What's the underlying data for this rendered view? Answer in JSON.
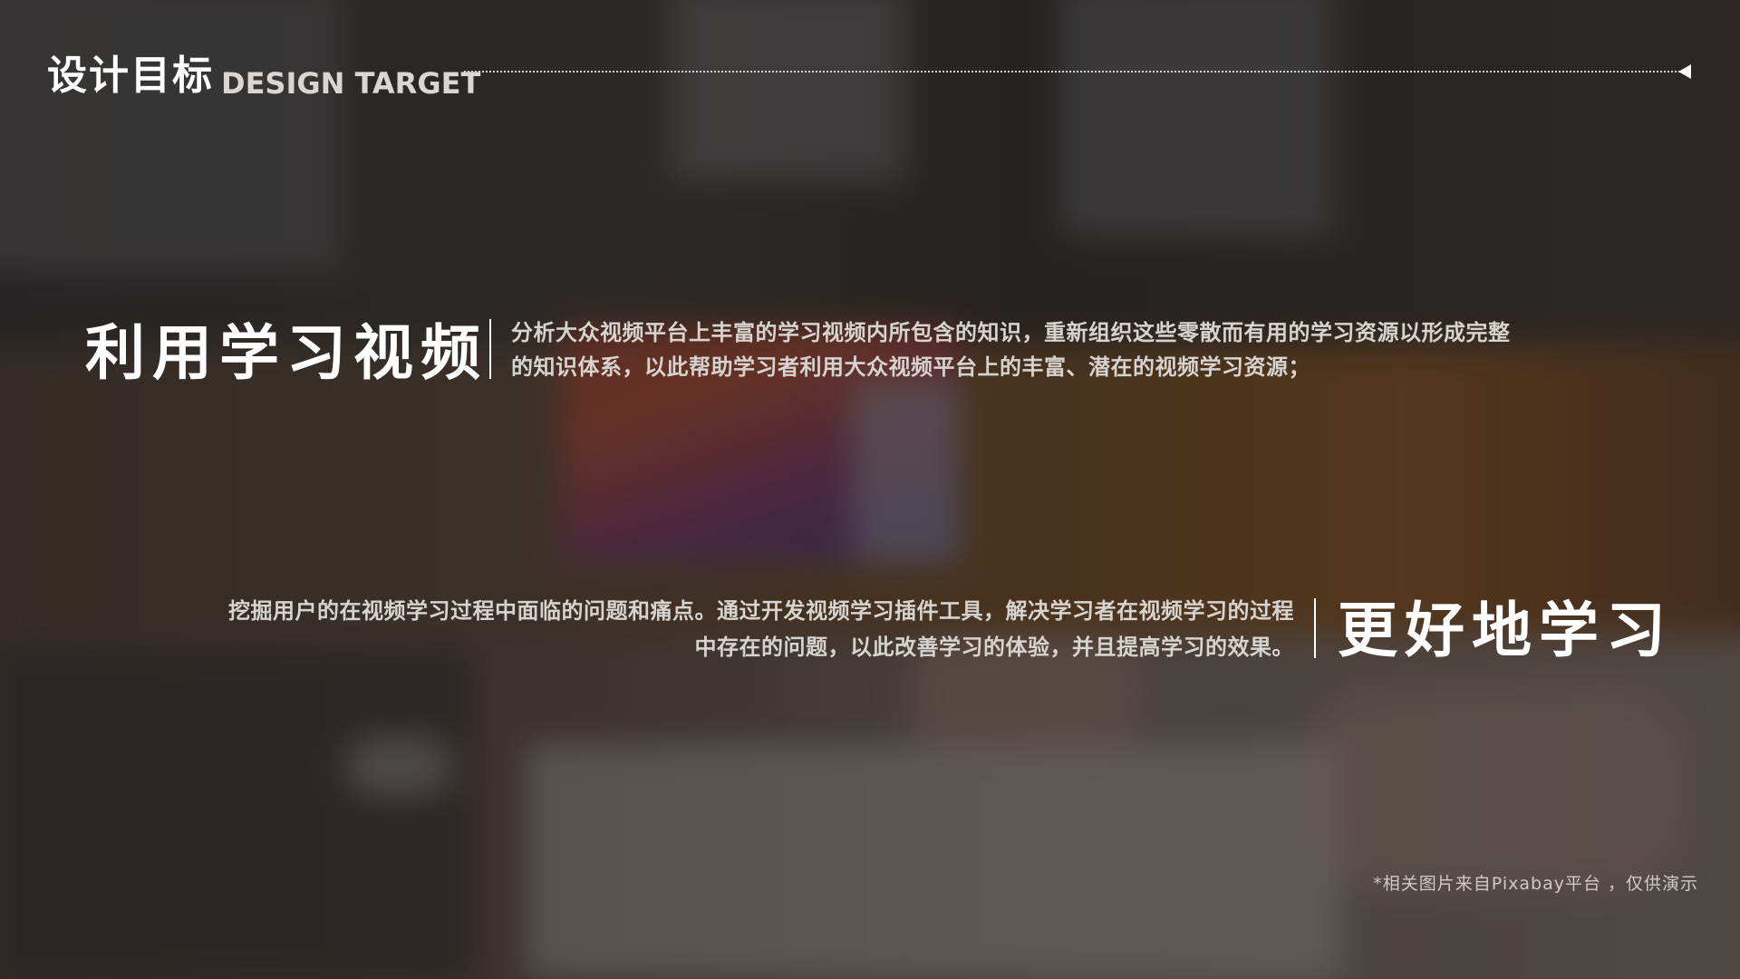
{
  "header": {
    "title": "设计目标",
    "subtitle": "DESIGN TARGET"
  },
  "blocks": [
    {
      "title": "利用学习视频",
      "text_line1": "分析大众视频平台上丰富的学习视频内所包含的知识，重新组织这些零散而有用的学习资源以形成完整",
      "text_line2": "的知识体系，以此帮助学习者利用大众视频平台上的丰富、潜在的视频学习资源；"
    },
    {
      "title": "更好地学习",
      "text_line1": "挖掘用户的在视频学习过程中面临的问题和痛点。通过开发视频学习插件工具，解决学习者在视频学习的过程",
      "text_line2": "中存在的问题，以此改善学习的体验，并且提高学习的效果。"
    }
  ],
  "footnote": "*相关图片来自Pixabay平台 ，仅供演示",
  "colors": {
    "title": "#ffffff",
    "body_text": "#d7d3cf",
    "overlay": "rgba(20,18,18,0.55)"
  }
}
